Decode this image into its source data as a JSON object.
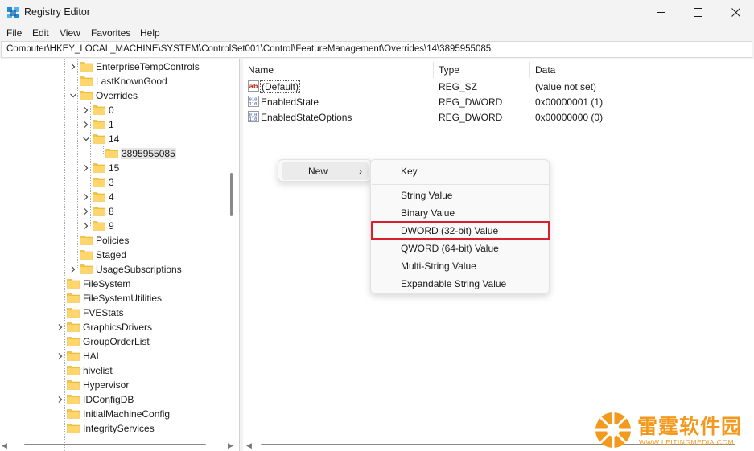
{
  "window": {
    "title": "Registry Editor",
    "controls": {
      "minimize": "—",
      "maximize": "☐",
      "close": "✕"
    }
  },
  "menu": [
    "File",
    "Edit",
    "View",
    "Favorites",
    "Help"
  ],
  "address": "Computer\\HKEY_LOCAL_MACHINE\\SYSTEM\\ControlSet001\\Control\\FeatureManagement\\Overrides\\14\\3895955085",
  "tree": {
    "items": [
      {
        "label": "EnterpriseTempControls",
        "expand": "collapsed"
      },
      {
        "label": "LastKnownGood",
        "expand": "none"
      },
      {
        "label": "Overrides",
        "expand": "expanded"
      },
      {
        "label": "0",
        "expand": "collapsed"
      },
      {
        "label": "1",
        "expand": "collapsed"
      },
      {
        "label": "14",
        "expand": "expanded"
      },
      {
        "label": "3895955085",
        "expand": "none",
        "selected": true
      },
      {
        "label": "15",
        "expand": "collapsed"
      },
      {
        "label": "3",
        "expand": "none"
      },
      {
        "label": "4",
        "expand": "collapsed"
      },
      {
        "label": "8",
        "expand": "collapsed"
      },
      {
        "label": "9",
        "expand": "collapsed"
      },
      {
        "label": "Policies",
        "expand": "none"
      },
      {
        "label": "Staged",
        "expand": "none"
      },
      {
        "label": "UsageSubscriptions",
        "expand": "collapsed"
      },
      {
        "label": "FileSystem",
        "expand": "none"
      },
      {
        "label": "FileSystemUtilities",
        "expand": "none"
      },
      {
        "label": "FVEStats",
        "expand": "none"
      },
      {
        "label": "GraphicsDrivers",
        "expand": "collapsed"
      },
      {
        "label": "GroupOrderList",
        "expand": "none"
      },
      {
        "label": "HAL",
        "expand": "collapsed"
      },
      {
        "label": "hivelist",
        "expand": "none"
      },
      {
        "label": "Hypervisor",
        "expand": "none"
      },
      {
        "label": "IDConfigDB",
        "expand": "collapsed"
      },
      {
        "label": "InitialMachineConfig",
        "expand": "none"
      },
      {
        "label": "IntegrityServices",
        "expand": "none"
      }
    ]
  },
  "list": {
    "columns": [
      "Name",
      "Type",
      "Data"
    ],
    "rows": [
      {
        "name": "(Default)",
        "type": "REG_SZ",
        "data": "(value not set)",
        "icon": "string-value-icon"
      },
      {
        "name": "EnabledState",
        "type": "REG_DWORD",
        "data": "0x00000001 (1)",
        "icon": "binary-value-icon"
      },
      {
        "name": "EnabledStateOptions",
        "type": "REG_DWORD",
        "data": "0x00000000 (0)",
        "icon": "binary-value-icon"
      }
    ]
  },
  "context_menu": {
    "new_label": "New",
    "arrow": "›"
  },
  "submenu": {
    "key": "Key",
    "items": [
      "String Value",
      "Binary Value",
      "DWORD (32-bit) Value",
      "QWORD (64-bit) Value",
      "Multi-String Value",
      "Expandable String Value"
    ],
    "highlighted": "DWORD (32-bit) Value",
    "highlight_color": "#d71f2d"
  },
  "watermark": {
    "title": "雷霆软件园",
    "url": "WWW.LEITINGMEDIA.COM",
    "color": "#f39a1e"
  },
  "colors": {
    "folder": "#f5c542",
    "selection": "#e5e5e5",
    "accent": "#0067c0"
  }
}
